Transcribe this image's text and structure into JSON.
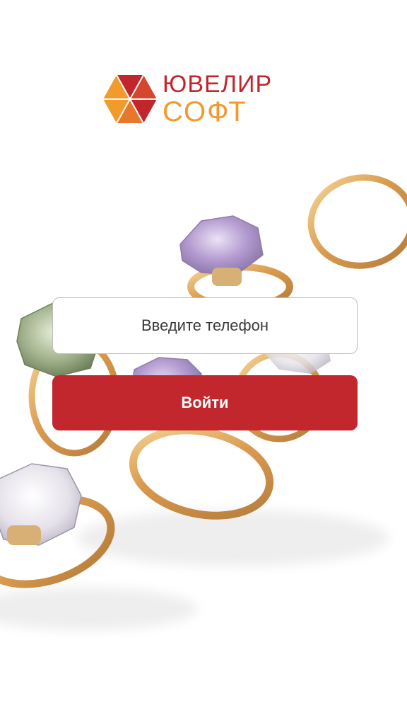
{
  "brand": {
    "line1": "ЮВЕЛИР",
    "line2": "СОФТ",
    "colors": {
      "red": "#c0262c",
      "orange": "#f39a2c"
    }
  },
  "login": {
    "phone_placeholder": "Введите телефон",
    "phone_value": "",
    "submit_label": "Войти",
    "submit_color": "#c1272d"
  },
  "background": {
    "image": "gold rings with colored gemstones",
    "icon": "rings-photo"
  }
}
